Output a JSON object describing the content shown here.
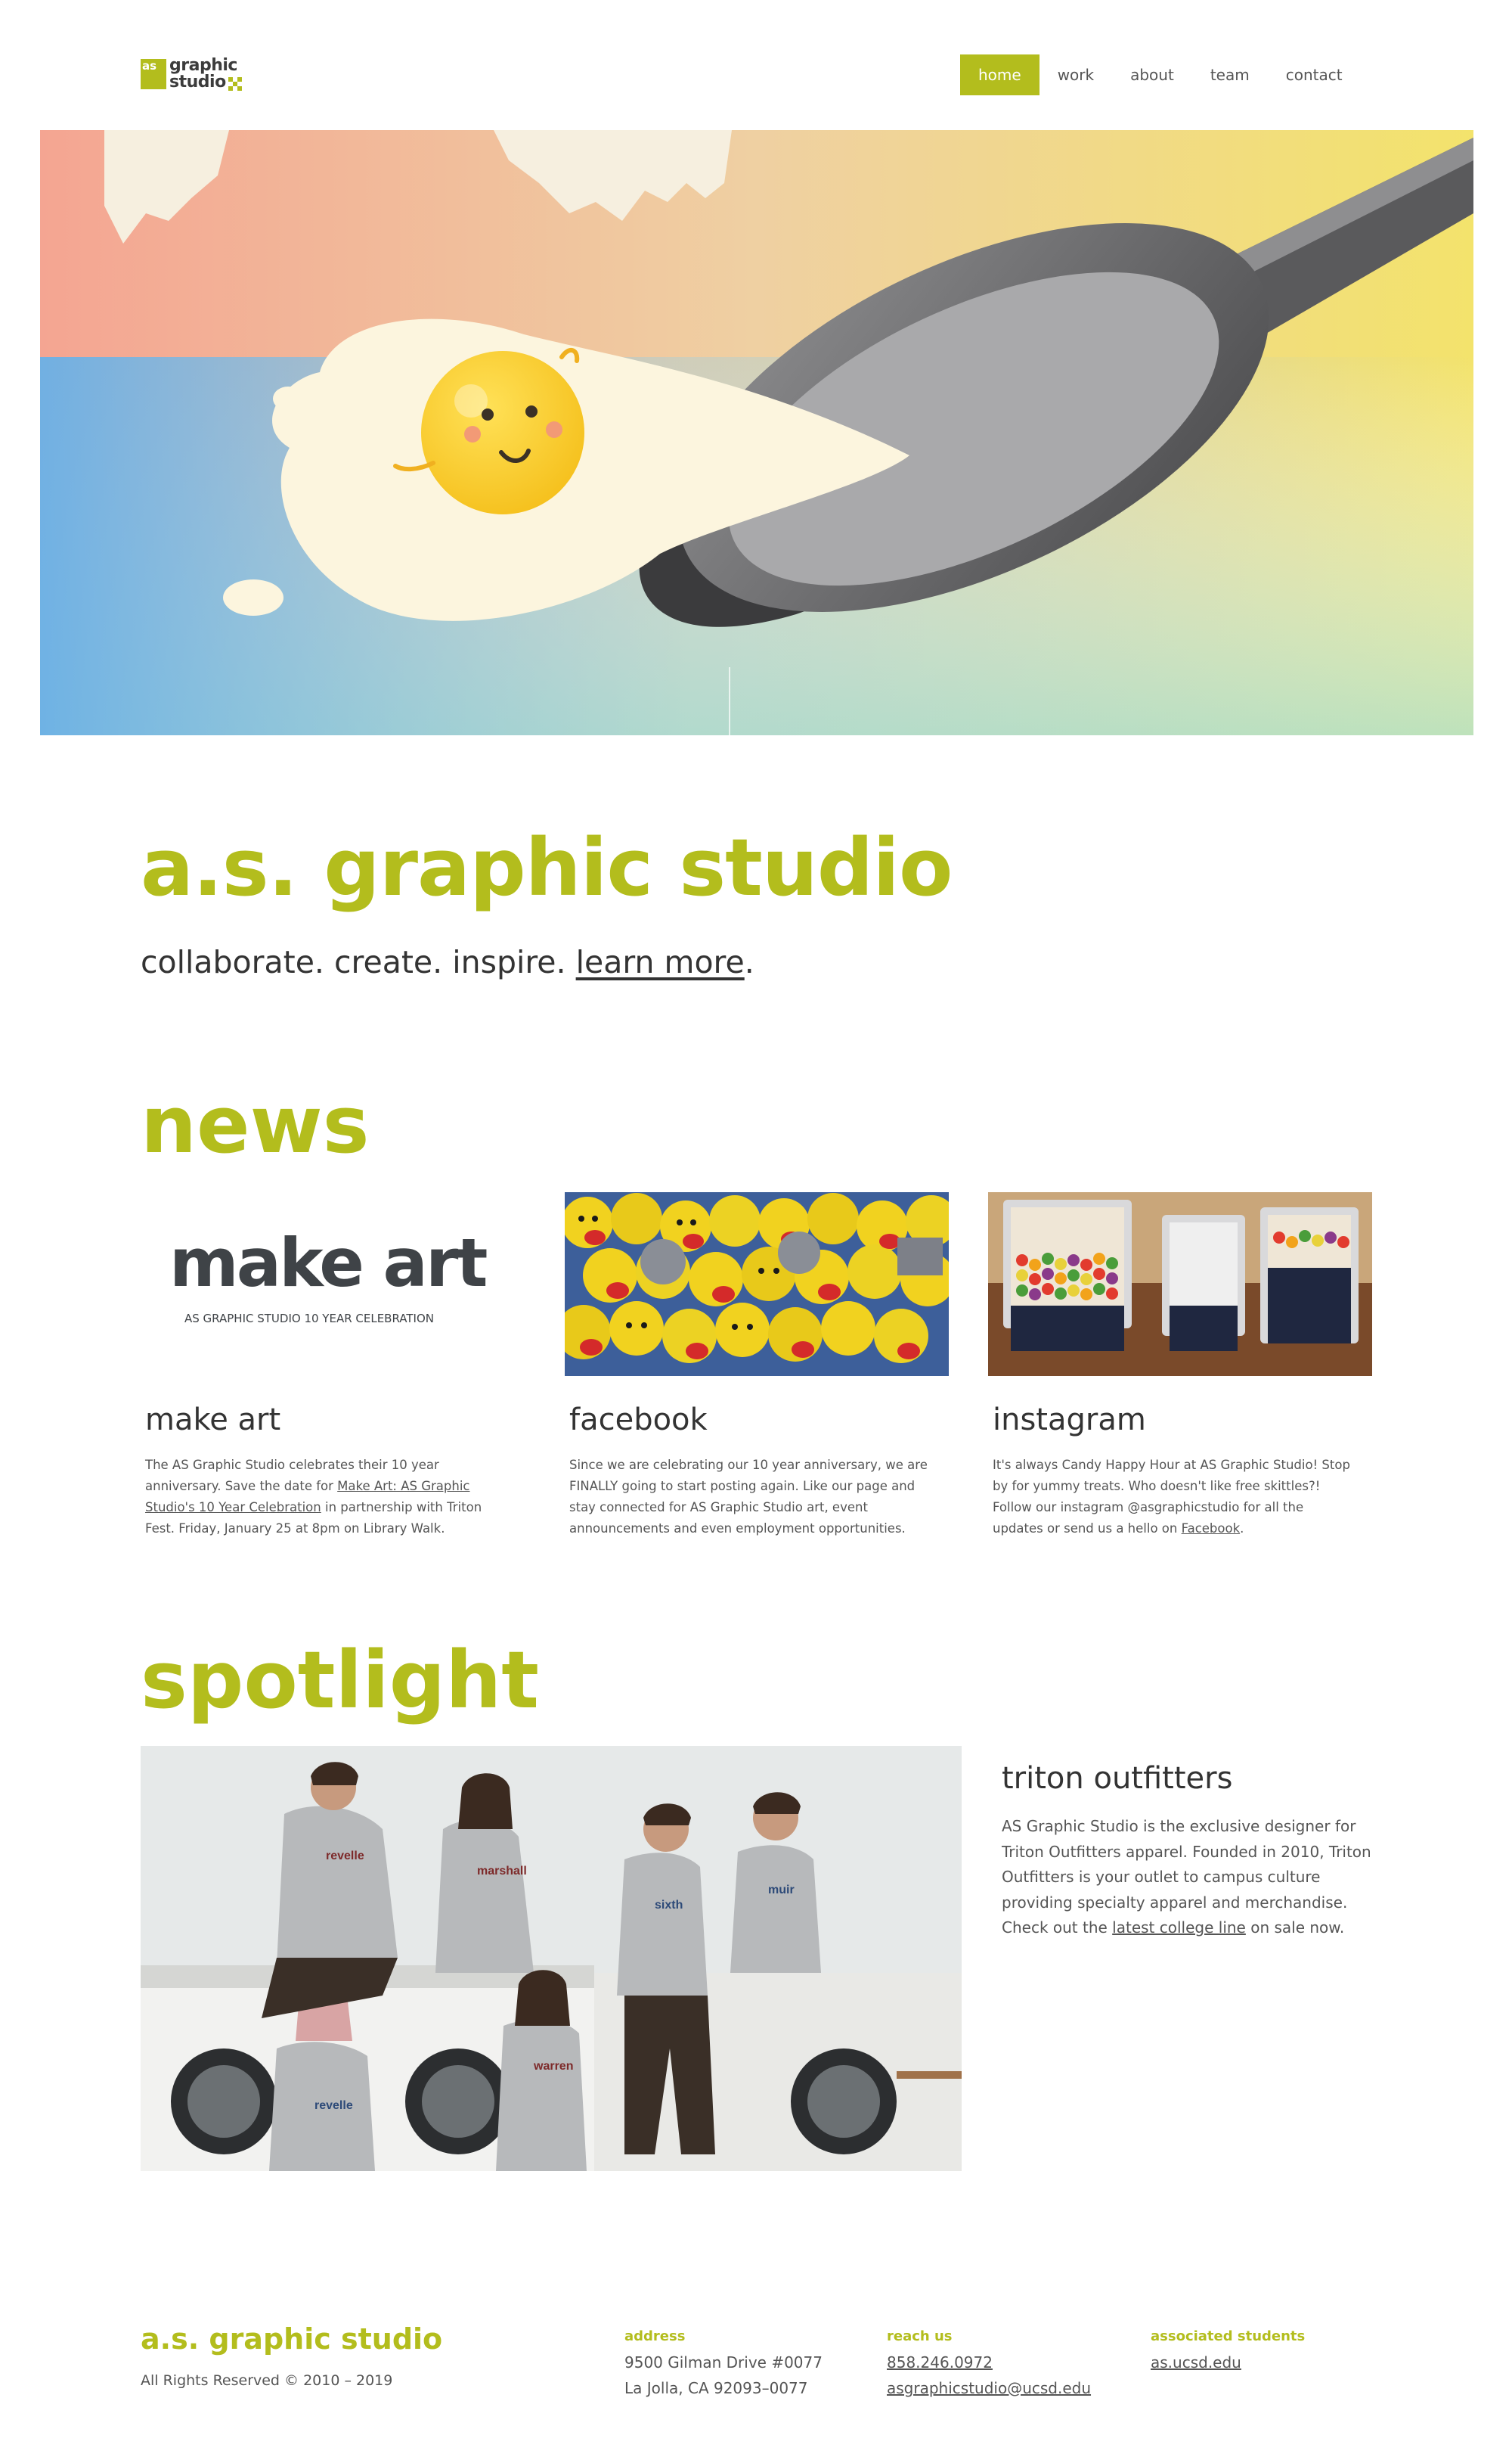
{
  "header": {
    "logo": {
      "mark_text": "as",
      "line1": "graphic",
      "line2": "studio"
    },
    "nav": [
      {
        "label": "home",
        "active": true
      },
      {
        "label": "work",
        "active": false
      },
      {
        "label": "about",
        "active": false
      },
      {
        "label": "team",
        "active": false
      },
      {
        "label": "contact",
        "active": false
      }
    ]
  },
  "intro": {
    "title": "a.s. graphic studio",
    "tagline_prefix": "collaborate. create. inspire. ",
    "tagline_link": "learn more",
    "tagline_suffix": "."
  },
  "news": {
    "heading": "news",
    "cards": [
      {
        "title": "make art",
        "image_text": "make art",
        "image_subtext": "AS GRAPHIC STUDIO 10 YEAR CELEBRATION",
        "body_before": "The AS Graphic Studio celebrates their 10 year anniversary. Save the date for ",
        "body_link": "Make Art: AS Graphic Studio's 10 Year Celebration",
        "body_after": " in partnership with Triton Fest. Friday, January 25 at 8pm on Library Walk."
      },
      {
        "title": "facebook",
        "body": "Since we are celebrating our 10 year anniversary, we are FINALLY going to start posting again. Like our page and stay connected for AS Graphic Studio art, event announcements and even employment opportunities."
      },
      {
        "title": "instagram",
        "body_before": "It's always Candy Happy Hour at AS Graphic Studio! Stop by for yummy treats. Who doesn't like free skittles?! Follow our instagram @asgraphicstudio for all the updates or send us a hello on ",
        "body_link": "Facebook",
        "body_after": "."
      }
    ]
  },
  "spotlight": {
    "heading": "spotlight",
    "title": "triton outfitters",
    "body_before": "AS Graphic Studio is the exclusive designer for Triton Outfitters apparel. Founded in 2010, Triton Outfitters is your outlet to campus culture providing specialty apparel and merchandise. Check out the ",
    "body_link": "latest college line",
    "body_after": " on sale now.",
    "shirt_labels": [
      "revelle",
      "marshall",
      "sixth",
      "muir",
      "warren",
      "revelle"
    ]
  },
  "footer": {
    "title": "a.s. graphic studio",
    "copyright": "All Rights Reserved © 2010 – 2019",
    "address": {
      "heading": "address",
      "line1": "9500 Gilman Drive #0077",
      "line2": "La Jolla, CA 92093–0077"
    },
    "reach": {
      "heading": "reach us",
      "phone": "858.246.0972",
      "email": "asgraphicstudio@ucsd.edu"
    },
    "associated": {
      "heading": "associated students",
      "link": "as.ucsd.edu"
    }
  },
  "colors": {
    "accent": "#b3bd1d",
    "text": "#333333",
    "body_text": "#555555"
  }
}
